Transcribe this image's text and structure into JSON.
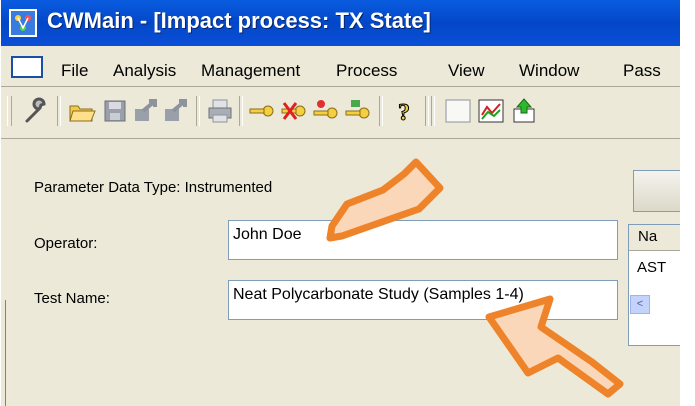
{
  "window": {
    "title": "CWMain - [Impact process: TX State]"
  },
  "menu": {
    "items": [
      "File",
      "Analysis",
      "Management",
      "Process",
      "View",
      "Window",
      "Pass"
    ]
  },
  "toolbar": {
    "icons": [
      "wrench-icon",
      "open-folder-icon",
      "save-icon",
      "export-icon",
      "import-icon",
      "print-icon",
      "key-icon",
      "key-delete-icon",
      "key-add-icon",
      "key-edit-icon",
      "help-icon",
      "blank-icon",
      "chart-icon",
      "upload-icon"
    ]
  },
  "form": {
    "parameter_label": "Parameter Data Type: Instrumented",
    "operator_label": "Operator:",
    "operator_value": "John Doe",
    "testname_label": "Test Name:",
    "testname_value": "Neat Polycarbonate Study (Samples 1-4)"
  },
  "grid": {
    "header": "Na",
    "cell": "AST",
    "scroll": "<"
  },
  "colors": {
    "titlebar": "#0347c8",
    "arrow_fill": "#fad7b8",
    "arrow_stroke": "#ee8329"
  }
}
